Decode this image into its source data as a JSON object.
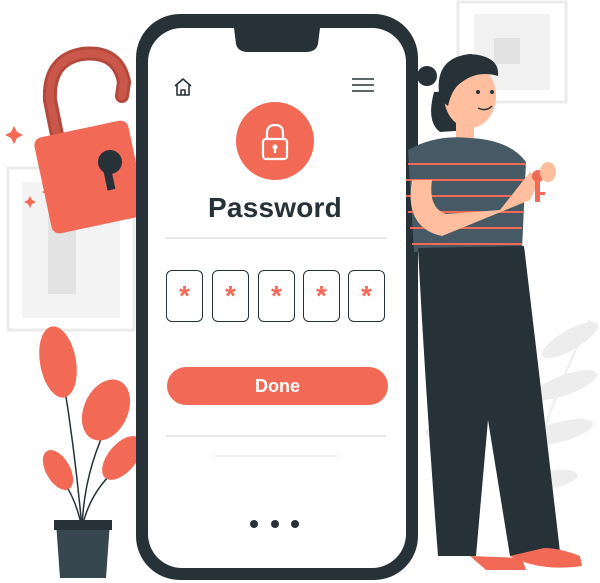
{
  "screen": {
    "title": "Password",
    "pin_masks": [
      "*",
      "*",
      "*",
      "*",
      "*"
    ],
    "done_label": "Done",
    "icons": {
      "home": "home-icon",
      "menu": "hamburger-menu-icon",
      "lock": "lock-icon"
    }
  },
  "colors": {
    "accent": "#f26a55",
    "dark": "#263238",
    "background": "#ffffff",
    "shadow": "#eeeeee"
  }
}
